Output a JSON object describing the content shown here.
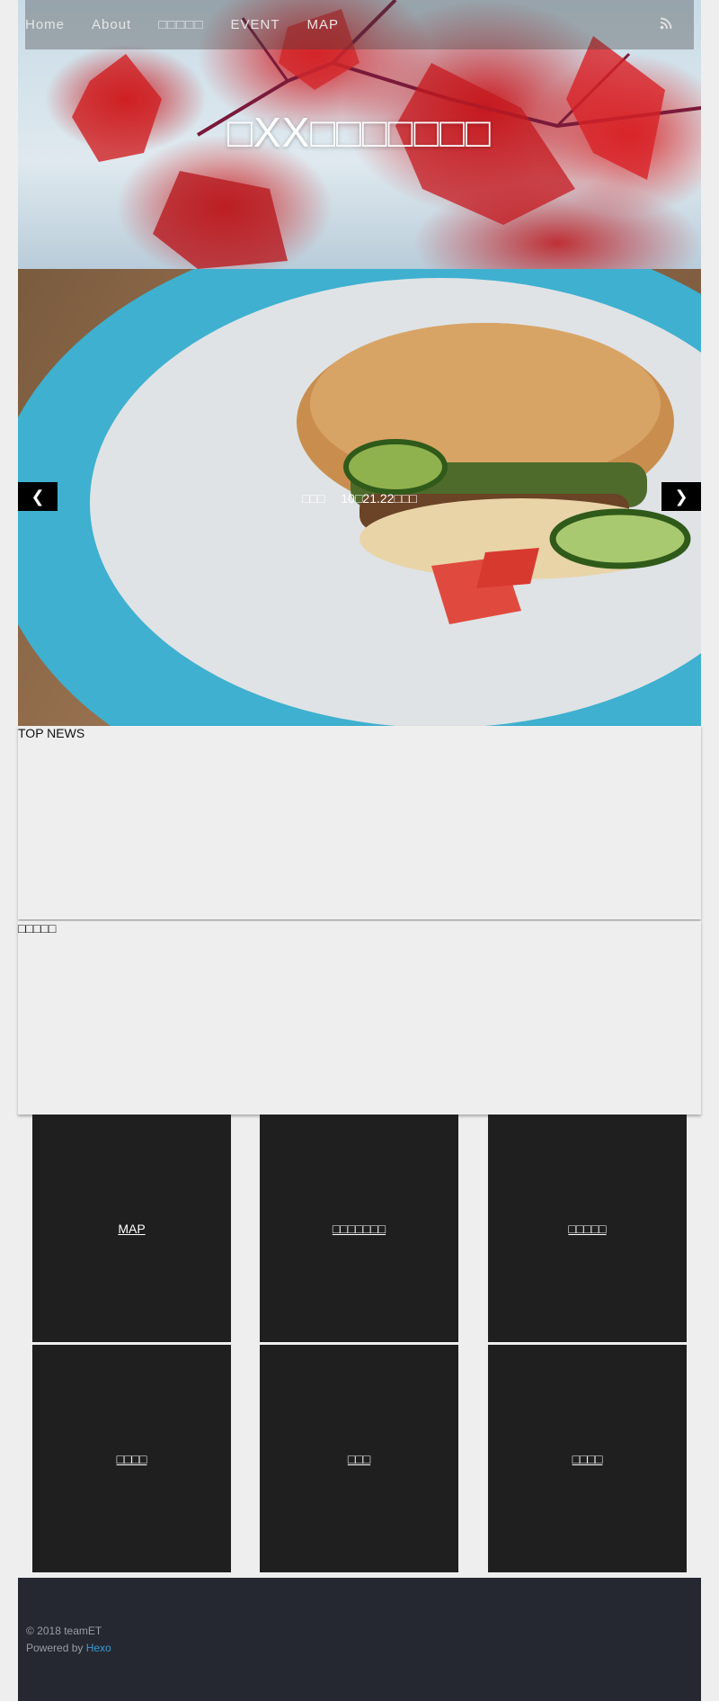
{
  "nav": {
    "items": [
      "Home",
      "About",
      "□□□□□",
      "EVENT",
      "MAP"
    ],
    "rss_icon": "rss-icon"
  },
  "header": {
    "title": "□XX□□□□□□□"
  },
  "slider": {
    "prev_label": "❮",
    "next_label": "❯",
    "caption": "□□□　 10□21.22□□□"
  },
  "sections": {
    "top_news": "TOP NEWS",
    "second": "□□□□□"
  },
  "tiles": [
    "MAP",
    "□□□□□□□",
    "□□□□□",
    "□□□□",
    "□□□",
    "□□□□"
  ],
  "footer": {
    "copyright": "© 2018 teamET",
    "powered_prefix": "Powered by ",
    "powered_link": "Hexo"
  },
  "colors": {
    "tile_bg": "#1f1f1f",
    "footer_bg": "#252830",
    "link_blue": "#3b9ad6",
    "page_bg": "#eeeeee"
  }
}
